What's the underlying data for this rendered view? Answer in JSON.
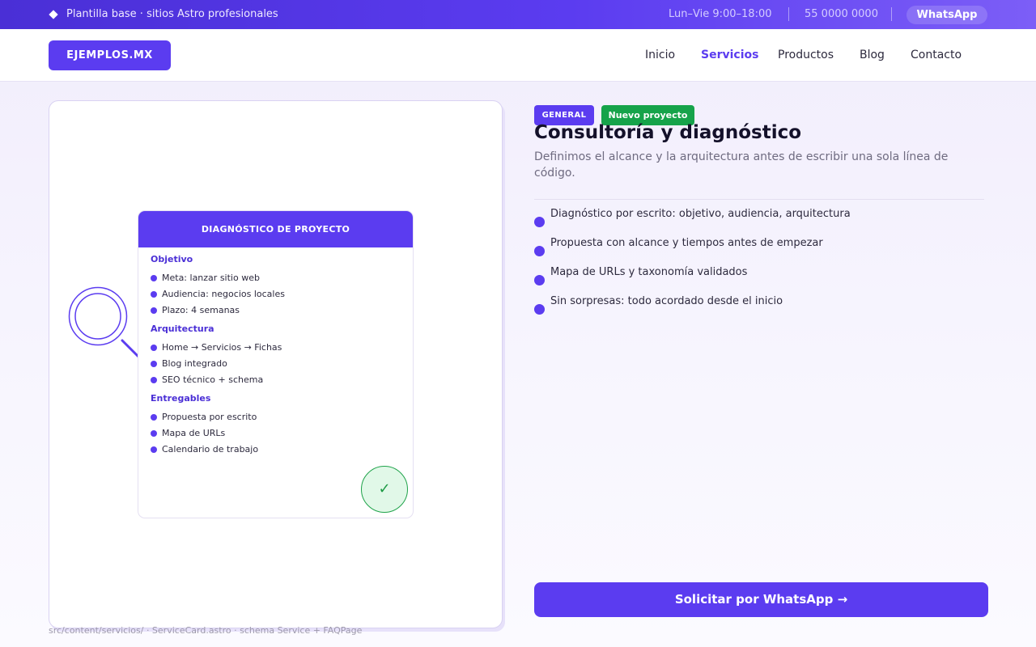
{
  "topbar": {
    "tagline": "Plantilla base · sitios Astro profesionales",
    "hours": "Lun–Vie  9:00–18:00",
    "phone": "55 0000 0000",
    "whatsapp": "WhatsApp"
  },
  "nav": {
    "logo": "EJEMPLOS.MX",
    "items": [
      {
        "label": "Inicio",
        "active": false
      },
      {
        "label": "Servicios",
        "active": true
      },
      {
        "label": "Productos",
        "active": false
      },
      {
        "label": "Blog",
        "active": false
      },
      {
        "label": "Contacto",
        "active": false
      }
    ]
  },
  "illustration": {
    "header": "DIAGNÓSTICO DE PROYECTO",
    "sections": [
      {
        "title": "Objetivo",
        "items": [
          "Meta: lanzar sitio web",
          "Audiencia: negocios locales",
          "Plazo: 4 semanas"
        ]
      },
      {
        "title": "Arquitectura",
        "items": [
          "Home → Servicios → Fichas",
          "Blog integrado",
          "SEO técnico + schema"
        ]
      },
      {
        "title": "Entregables",
        "items": [
          "Propuesta por escrito",
          "Mapa de URLs",
          "Calendario de trabajo"
        ]
      }
    ],
    "check_symbol": "✓"
  },
  "service": {
    "badge_category": "GENERAL",
    "badge_new": "Nuevo proyecto",
    "title": "Consultoría y diagnóstico",
    "subtitle": "Definimos el alcance y la arquitectura antes de escribir una sola línea de código.",
    "features": [
      "Diagnóstico por escrito: objetivo, audiencia, arquitectura",
      "Propuesta con alcance y tiempos antes de empezar",
      "Mapa de URLs y taxonomía validados",
      "Sin sorpresas: todo acordado desde el inicio"
    ],
    "cta": "Solicitar por WhatsApp →"
  },
  "source_note": "src/content/servicios/ · ServiceCard.astro · schema Service + FAQPage",
  "colors": {
    "accent": "#5b3cf0",
    "accent_dark": "#4a2fd6",
    "success": "#16a34a"
  },
  "icons": {
    "topbar_bullet": "diamond-icon",
    "illustration": "magnifier-icon",
    "done": "check-icon"
  }
}
